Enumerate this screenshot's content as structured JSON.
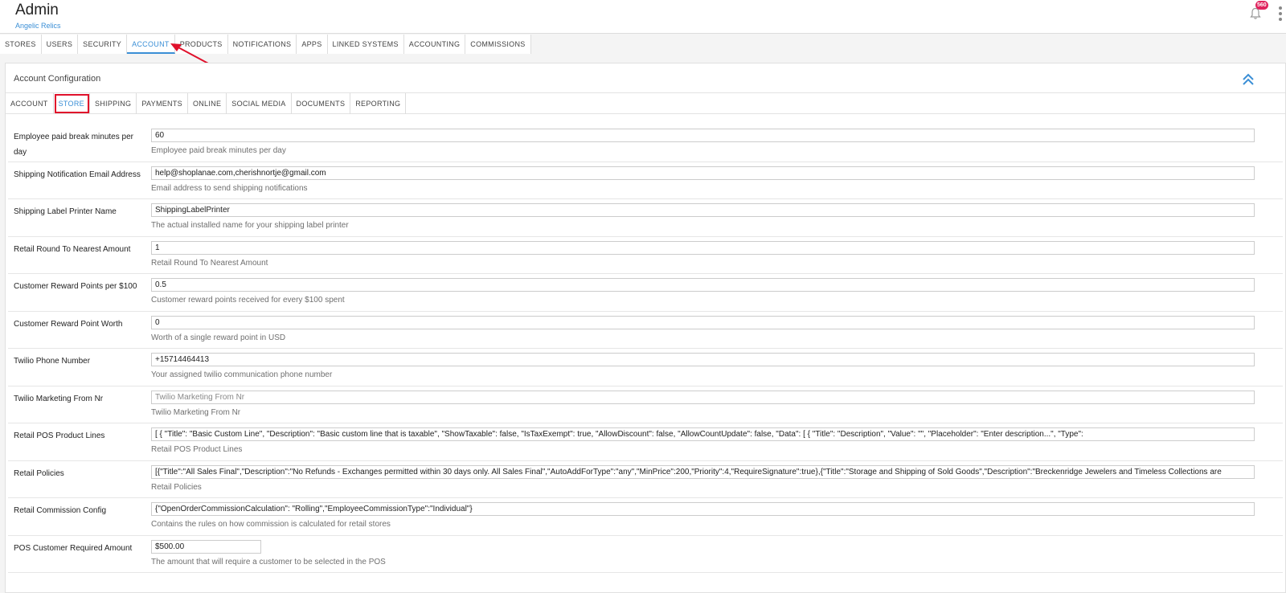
{
  "header": {
    "title": "Admin",
    "subtitle": "Angelic Relics",
    "notification_count": "560"
  },
  "main_tabs": [
    {
      "label": "STORES"
    },
    {
      "label": "USERS"
    },
    {
      "label": "SECURITY"
    },
    {
      "label": "ACCOUNT",
      "active": true
    },
    {
      "label": "PRODUCTS"
    },
    {
      "label": "NOTIFICATIONS"
    },
    {
      "label": "APPS"
    },
    {
      "label": "LINKED SYSTEMS"
    },
    {
      "label": "ACCOUNTING"
    },
    {
      "label": "COMMISSIONS"
    }
  ],
  "panel": {
    "title": "Account Configuration",
    "sub_tabs": [
      {
        "label": "ACCOUNT"
      },
      {
        "label": "STORE",
        "active": true
      },
      {
        "label": "SHIPPING"
      },
      {
        "label": "PAYMENTS"
      },
      {
        "label": "ONLINE"
      },
      {
        "label": "SOCIAL MEDIA"
      },
      {
        "label": "DOCUMENTS"
      },
      {
        "label": "REPORTING"
      }
    ]
  },
  "settings": [
    {
      "label": "Employee paid break minutes per day",
      "value": "60",
      "help": "Employee paid break minutes per day"
    },
    {
      "label": "Shipping Notification Email Address",
      "value": "help@shoplanae.com,cherishnortje@gmail.com",
      "help": "Email address to send shipping notifications"
    },
    {
      "label": "Shipping Label Printer Name",
      "value": "ShippingLabelPrinter",
      "help": "The actual installed name for your shipping label printer"
    },
    {
      "label": "Retail Round To Nearest Amount",
      "value": "1",
      "help": "Retail Round To Nearest Amount"
    },
    {
      "label": "Customer Reward Points per $100",
      "value": "0.5",
      "help": "Customer reward points received for every $100 spent"
    },
    {
      "label": "Customer Reward Point Worth",
      "value": "0",
      "help": "Worth of a single reward point in USD"
    },
    {
      "label": "Twilio Phone Number",
      "value": "+15714464413",
      "help": "Your assigned twilio communication phone number"
    },
    {
      "label": "Twilio Marketing From Nr",
      "placeholder": "Twilio Marketing From Nr",
      "help": "Twilio Marketing From Nr"
    },
    {
      "label": "Retail POS Product Lines",
      "value": "[   {     \"Title\": \"Basic Custom Line\",     \"Description\": \"Basic custom line that is taxable\",     \"ShowTaxable\": false,     \"IsTaxExempt\": true,     \"AllowDiscount\": false,     \"AllowCountUpdate\": false,     \"Data\": [       {         \"Title\": \"Description\",         \"Value\": \"\",         \"Placeholder\": \"Enter description...\",         \"Type\":",
      "help": "Retail POS Product Lines"
    },
    {
      "label": "Retail Policies",
      "value": "[{\"Title\":\"All Sales Final\",\"Description\":\"No Refunds - Exchanges permitted within 30 days only. All Sales Final\",\"AutoAddForType\":\"any\",\"MinPrice\":200,\"Priority\":4,\"RequireSignature\":true},{\"Title\":\"Storage and Shipping of Sold Goods\",\"Description\":\"Breckenridge Jewelers and Timeless Collections are",
      "help": "Retail Policies"
    },
    {
      "label": "Retail Commission Config",
      "value": "{\"OpenOrderCommissionCalculation\": \"Rolling\",\"EmployeeCommissionType\":\"Individual\"}",
      "help": "Contains the rules on how commission is calculated for retail stores"
    },
    {
      "label": "POS Customer Required Amount",
      "value": "$500.00",
      "help": "The amount that will require a customer to be selected in the POS",
      "short": true
    }
  ],
  "colors": {
    "accent": "#3b8fd6",
    "highlight": "#e0102b",
    "badge": "#e0245e"
  }
}
